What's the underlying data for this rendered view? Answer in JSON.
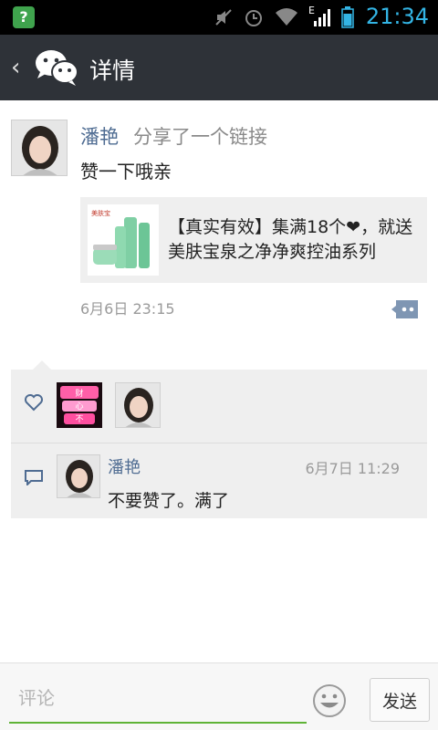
{
  "status_bar": {
    "time": "21:34",
    "network": "E",
    "app_icon_char": "?"
  },
  "header": {
    "title": "详情"
  },
  "post": {
    "author": "潘艳",
    "action": "分享了一个链接",
    "text": "赞一下哦亲",
    "link_title": "【真实有效】集满18个❤，就送美肤宝泉之净净爽控油系列",
    "link_thumb_brand": "美肤宝",
    "time": "6月6日 23:15"
  },
  "likes": {
    "users": [
      {
        "avatar_text": [
          "财",
          "心",
          "不"
        ]
      },
      {
        "avatar_text": []
      }
    ]
  },
  "comments": [
    {
      "author": "潘艳",
      "time": "6月7日 11:29",
      "text": "不要赞了。满了"
    }
  ],
  "input": {
    "placeholder": "评论",
    "send_label": "发送"
  },
  "colors": {
    "accent_green": "#5fb336",
    "name_blue": "#4f6c92",
    "titlebar": "#2e3238",
    "status_time": "#33b5e5"
  }
}
